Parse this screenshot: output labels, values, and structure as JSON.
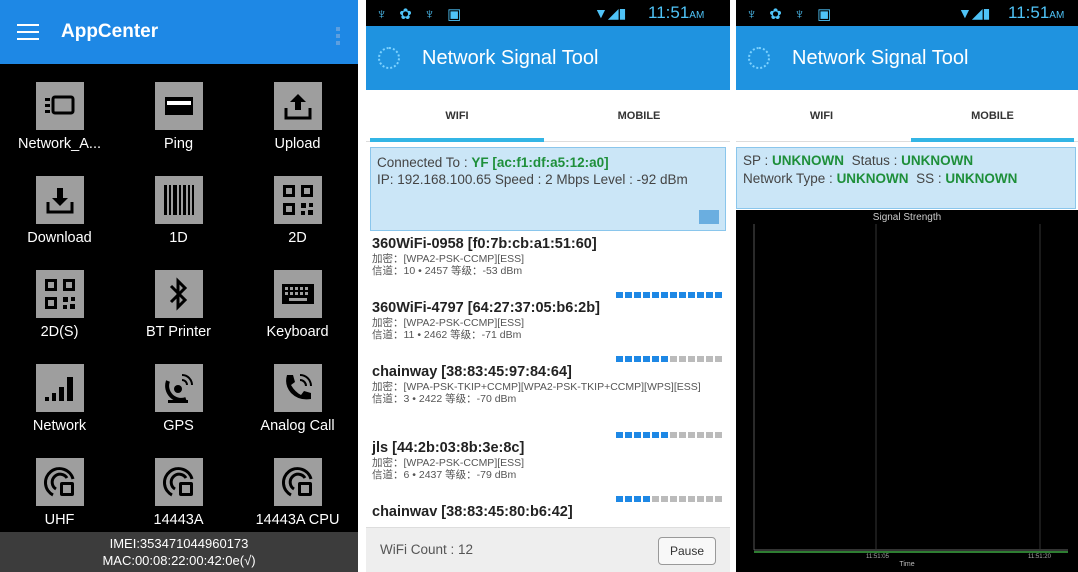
{
  "app_center": {
    "title": "AppCenter",
    "items": [
      {
        "label": "Network_A...",
        "icon": "network-analyzer-icon"
      },
      {
        "label": "Ping",
        "icon": "ping-icon"
      },
      {
        "label": "Upload",
        "icon": "upload-icon"
      },
      {
        "label": "Download",
        "icon": "download-icon"
      },
      {
        "label": "1D",
        "icon": "barcode-icon"
      },
      {
        "label": "2D",
        "icon": "qr-code-icon"
      },
      {
        "label": "2D(S)",
        "icon": "qr-code-icon"
      },
      {
        "label": "BT Printer",
        "icon": "bluetooth-icon"
      },
      {
        "label": "Keyboard",
        "icon": "keyboard-icon"
      },
      {
        "label": "Network",
        "icon": "signal-bars-icon"
      },
      {
        "label": "GPS",
        "icon": "satellite-icon"
      },
      {
        "label": "Analog Call",
        "icon": "phone-icon"
      },
      {
        "label": "UHF",
        "icon": "rfid-icon"
      },
      {
        "label": "14443A",
        "icon": "rfid-icon"
      },
      {
        "label": "14443A CPU",
        "icon": "rfid-icon"
      }
    ],
    "footer": {
      "imei": "IMEI:353471044960173",
      "mac": "MAC:00:08:22:00:42:0e(√)"
    }
  },
  "status_bar": {
    "time": "11:51",
    "ampm": "AM"
  },
  "signal_tool": {
    "title": "Network Signal Tool",
    "tabs": [
      "WIFI",
      "MOBILE"
    ]
  },
  "wifi": {
    "connected_label": "Connected To :",
    "connected_value": "YF [ac:f1:df:a5:12:a0]",
    "ip_line": "IP: 192.168.100.65  Speed :  2 Mbps  Level : -92 dBm",
    "networks": [
      {
        "ssid": "360WiFi-0958 [f0:7b:cb:a1:51:60]",
        "security": "加密：[WPA2-PSK-CCMP][ESS]",
        "channel": "信道：10 • 2457  等级：-53 dBm",
        "filled": 12
      },
      {
        "ssid": "360WiFi-4797 [64:27:37:05:b6:2b]",
        "security": "加密：[WPA2-PSK-CCMP][ESS]",
        "channel": "信道：11 • 2462  等级：-71 dBm",
        "filled": 6
      },
      {
        "ssid": "chainway [38:83:45:97:84:64]",
        "security": "加密：[WPA-PSK-TKIP+CCMP][WPA2-PSK-TKIP+CCMP][WPS][ESS]",
        "channel": "信道：3 • 2422  等级：-70 dBm",
        "filled": 6
      },
      {
        "ssid": "jls [44:2b:03:8b:3e:8c]",
        "security": "加密：[WPA2-PSK-CCMP][ESS]",
        "channel": "信道：6 • 2437  等级：-79 dBm",
        "filled": 4
      },
      {
        "ssid": "chainwav [38:83:45:80:b6:42]",
        "security": "",
        "channel": "",
        "filled": 0
      }
    ],
    "count_label": "WiFi Count :",
    "count_value": "12",
    "pause_label": "Pause"
  },
  "mobile": {
    "sp_label": "SP :",
    "sp_value": "UNKNOWN",
    "status_label": "Status :",
    "status_value": "UNKNOWN",
    "nettype_label": "Network Type :",
    "nettype_value": "UNKNOWN",
    "ss_label": "SS :",
    "ss_value": "UNKNOWN",
    "chart_title": "Signal Strength",
    "x_label": "Time",
    "ticks": [
      "11:51:05",
      "11:51:20"
    ]
  },
  "colors": {
    "accent": "#1e88e5",
    "highlight_green": "#1e8f3a",
    "tab_indicator": "#33b5e5"
  }
}
